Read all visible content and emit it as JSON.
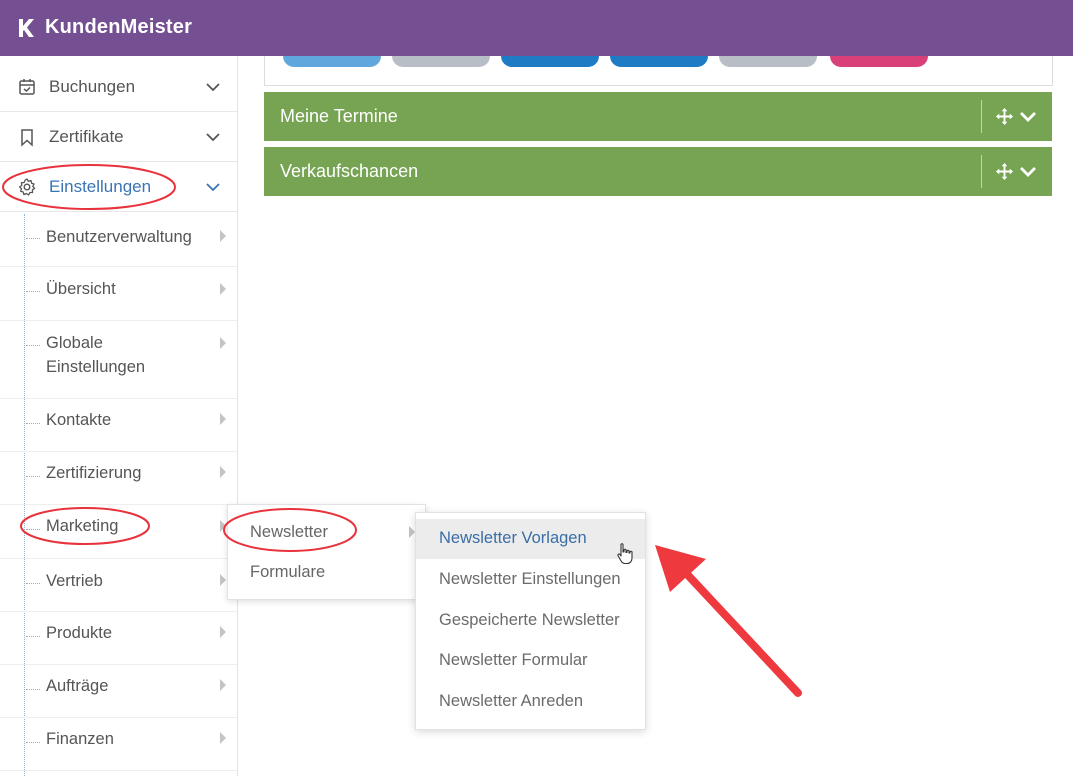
{
  "app": {
    "name": "KundenMeister"
  },
  "sidebar": {
    "items": [
      {
        "label": "Buchungen",
        "icon": "calendar-check-icon"
      },
      {
        "label": "Zertifikate",
        "icon": "bookmark-icon"
      },
      {
        "label": "Einstellungen",
        "icon": "gear-icon",
        "active": true
      }
    ],
    "subitems": [
      {
        "label": "Benutzerverwaltung"
      },
      {
        "label": "Übersicht"
      },
      {
        "label_line1": "Globale",
        "label_line2": "Einstellungen"
      },
      {
        "label": "Kontakte"
      },
      {
        "label": "Zertifizierung"
      },
      {
        "label": "Marketing"
      },
      {
        "label": "Vertrieb"
      },
      {
        "label": "Produkte"
      },
      {
        "label": "Aufträge"
      },
      {
        "label": "Finanzen"
      }
    ]
  },
  "panels": [
    {
      "title": "Meine Termine"
    },
    {
      "title": "Verkaufschancen"
    }
  ],
  "flyout_marketing": {
    "items": [
      {
        "label": "Newsletter"
      },
      {
        "label": "Formulare"
      }
    ]
  },
  "flyout_newsletter": {
    "items": [
      {
        "label": "Newsletter Vorlagen",
        "hovered": true
      },
      {
        "label": "Newsletter Einstellungen"
      },
      {
        "label": "Gespeicherte Newsletter"
      },
      {
        "label": "Newsletter Formular"
      },
      {
        "label": "Newsletter Anreden"
      }
    ]
  },
  "colors": {
    "topbar": "#744f91",
    "panel": "#76a452",
    "active_link": "#3a74b5",
    "annotation": "#e8323c"
  }
}
